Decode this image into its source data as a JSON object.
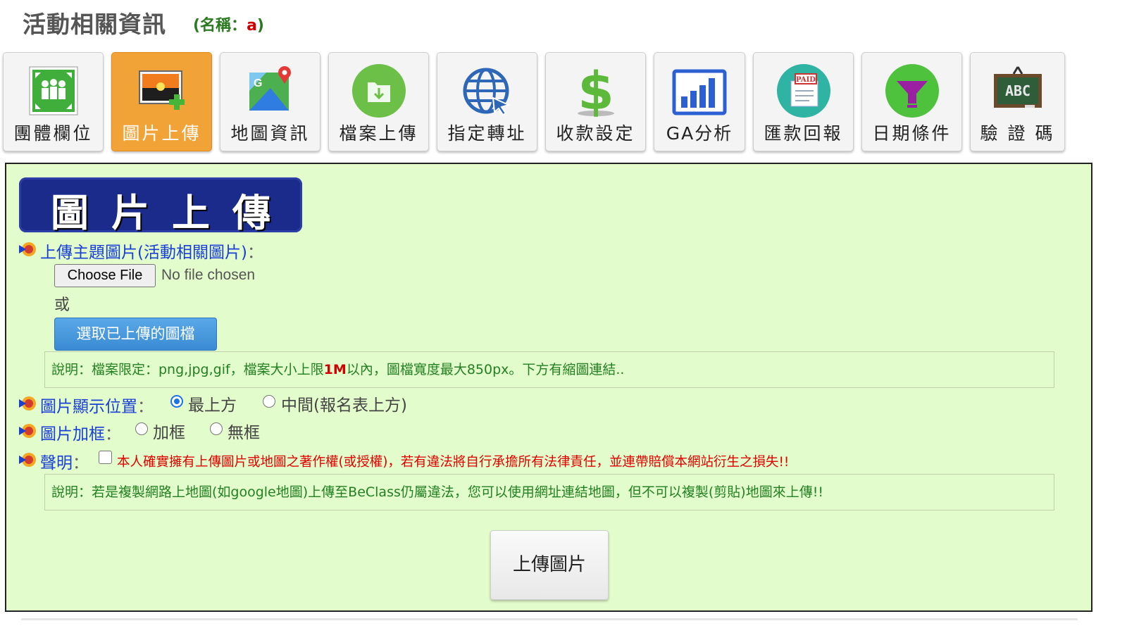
{
  "header": {
    "title": "活動相關資訊",
    "name_prefix": "(名稱：",
    "name_value": "a",
    "name_suffix": ")"
  },
  "tabs": [
    {
      "label": "團體欄位",
      "icon": "group-fields-icon",
      "active": false
    },
    {
      "label": "圖片上傳",
      "icon": "image-upload-icon",
      "active": true
    },
    {
      "label": "地圖資訊",
      "icon": "map-icon",
      "active": false
    },
    {
      "label": "檔案上傳",
      "icon": "file-upload-icon",
      "active": false
    },
    {
      "label": "指定轉址",
      "icon": "globe-redirect-icon",
      "active": false
    },
    {
      "label": "收款設定",
      "icon": "dollar-icon",
      "active": false
    },
    {
      "label": "GA分析",
      "icon": "bar-chart-icon",
      "active": false
    },
    {
      "label": "匯款回報",
      "icon": "paid-receipt-icon",
      "active": false
    },
    {
      "label": "日期條件",
      "icon": "filter-icon",
      "active": false
    },
    {
      "label": "驗 證 碼",
      "icon": "abc-board-icon",
      "active": false
    }
  ],
  "panel": {
    "banner": "圖片上傳",
    "upload_label": "上傳主題圖片(活動相關圖片)",
    "colon": "：",
    "file_button": "Choose File",
    "file_status": "No file chosen",
    "or": "或",
    "pick_button": "選取已上傳的圖檔",
    "note1_a": "說明：檔案限定：png,jpg,gif，檔案大小上限",
    "note1_red": "1M",
    "note1_b": "以內，圖檔寬度最大850px。下方有縮圖連結..",
    "position_label": "圖片顯示位置",
    "position_options": [
      "最上方",
      "中間(報名表上方)"
    ],
    "position_selected": "最上方",
    "frame_label": "圖片加框",
    "frame_options": [
      "加框",
      "無框"
    ],
    "declare_label": "聲明",
    "declare_text": "本人確實擁有上傳圖片或地圖之著作權(或授權)，若有違法將自行承擔所有法律責任，並連帶賠償本網站衍生之損失!!",
    "note2": "說明：若是複製網路上地圖(如google地圖)上傳至BeClass仍屬違法，您可以使用網址連結地圖，但不可以複製(剪貼)地圖來上傳!!",
    "submit_button": "上傳圖片"
  },
  "colors": {
    "panel_bg": "#e2fccb",
    "active_tab": "#f2a337",
    "label_blue": "#1a3fd6",
    "note_green": "#238022",
    "warning_red": "#e00000"
  }
}
